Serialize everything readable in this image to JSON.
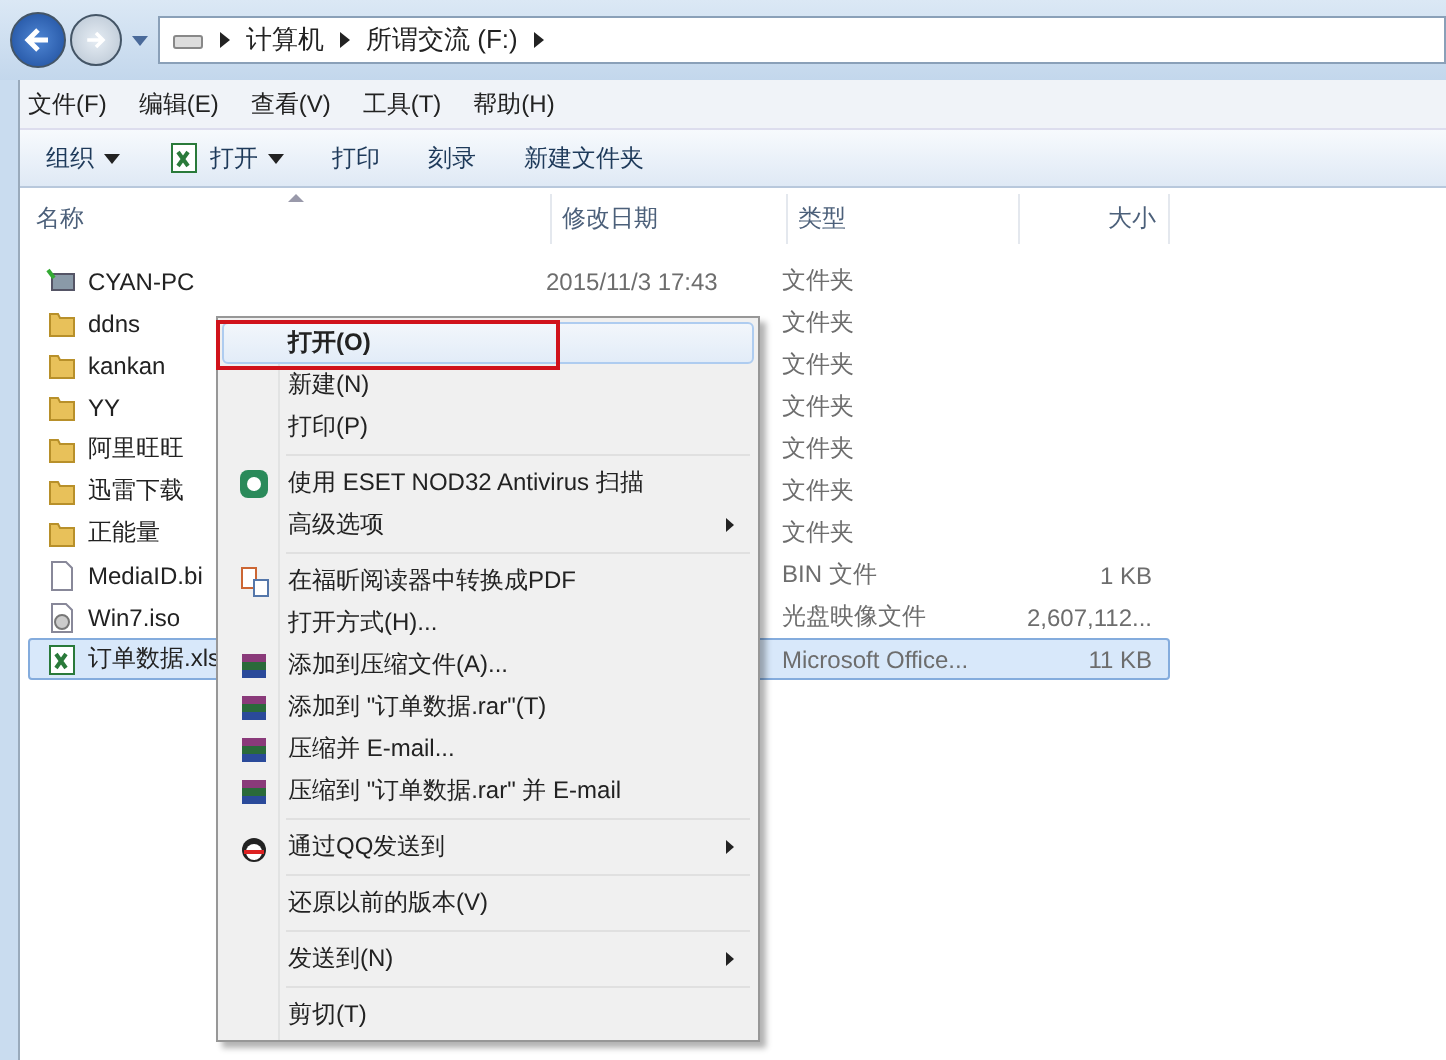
{
  "address_bar": {
    "crumbs": [
      "计算机",
      "所谓交流 (F:)"
    ]
  },
  "menu_bar": [
    "文件(F)",
    "编辑(E)",
    "查看(V)",
    "工具(T)",
    "帮助(H)"
  ],
  "toolbar": [
    {
      "label": "组织",
      "dropdown": true
    },
    {
      "label": "打开",
      "dropdown": true
    },
    {
      "label": "打印",
      "dropdown": false
    },
    {
      "label": "刻录",
      "dropdown": false
    },
    {
      "label": "新建文件夹",
      "dropdown": false
    }
  ],
  "columns": [
    "名称",
    "修改日期",
    "类型",
    "大小"
  ],
  "rows": [
    {
      "kind": "computer",
      "name": "CYAN-PC",
      "date": "2015/11/3 17:43",
      "type": "文件夹",
      "selected": false
    },
    {
      "kind": "folder",
      "name": "ddns",
      "type": "文件夹",
      "selected": false
    },
    {
      "kind": "folder",
      "name": "kankan",
      "type": "文件夹",
      "selected": false
    },
    {
      "kind": "folder",
      "name": "YY",
      "type": "文件夹",
      "selected": false
    },
    {
      "kind": "folder",
      "name": "阿里旺旺",
      "type": "文件夹",
      "selected": false
    },
    {
      "kind": "folder",
      "name": "迅雷下载",
      "type": "文件夹",
      "selected": false
    },
    {
      "kind": "folder",
      "name": "正能量",
      "type": "文件夹",
      "selected": false
    },
    {
      "kind": "file",
      "name": "MediaID.bi",
      "type": "BIN 文件",
      "size": "1 KB",
      "selected": false
    },
    {
      "kind": "disc",
      "name": "Win7.iso",
      "type": "光盘映像文件",
      "size": "2,607,112...",
      "selected": false
    },
    {
      "kind": "spreadsheet",
      "name": "订单数据.xls",
      "type": "Microsoft Office...",
      "size": "11 KB",
      "selected": true
    }
  ],
  "context_menu": [
    {
      "kind": "plain",
      "label": "打开(O)",
      "bold": true,
      "submenu": false,
      "selected": true,
      "annotated": true
    },
    {
      "kind": "plain",
      "label": "新建(N)",
      "bold": false,
      "submenu": false,
      "selected": false,
      "annotated": false
    },
    {
      "kind": "plain",
      "label": "打印(P)",
      "bold": false,
      "submenu": false,
      "selected": false,
      "annotated": false
    },
    {
      "kind": "separator"
    },
    {
      "kind": "scan",
      "label": "使用 ESET NOD32 Antivirus 扫描",
      "bold": false,
      "submenu": false,
      "selected": false,
      "annotated": false
    },
    {
      "kind": "plain",
      "label": "高级选项",
      "bold": false,
      "submenu": true,
      "selected": false,
      "annotated": false
    },
    {
      "kind": "separator"
    },
    {
      "kind": "pdf",
      "label": "在福昕阅读器中转换成PDF",
      "bold": false,
      "submenu": false,
      "selected": false,
      "annotated": false
    },
    {
      "kind": "plain",
      "label": "打开方式(H)...",
      "bold": false,
      "submenu": false,
      "selected": false,
      "annotated": false
    },
    {
      "kind": "archive",
      "label": "添加到压缩文件(A)...",
      "bold": false,
      "submenu": false,
      "selected": false,
      "annotated": false
    },
    {
      "kind": "archive",
      "label": "添加到 \"订单数据.rar\"(T)",
      "bold": false,
      "submenu": false,
      "selected": false,
      "annotated": false
    },
    {
      "kind": "archive",
      "label": "压缩并 E-mail...",
      "bold": false,
      "submenu": false,
      "selected": false,
      "annotated": false
    },
    {
      "kind": "archive",
      "label": "压缩到 \"订单数据.rar\" 并 E-mail",
      "bold": false,
      "submenu": false,
      "selected": false,
      "annotated": false
    },
    {
      "kind": "separator"
    },
    {
      "kind": "qq",
      "label": "通过QQ发送到",
      "bold": false,
      "submenu": true,
      "selected": false,
      "annotated": false
    },
    {
      "kind": "separator"
    },
    {
      "kind": "plain",
      "label": "还原以前的版本(V)",
      "bold": false,
      "submenu": false,
      "selected": false,
      "annotated": false
    },
    {
      "kind": "separator"
    },
    {
      "kind": "plain",
      "label": "发送到(N)",
      "bold": false,
      "submenu": true,
      "selected": false,
      "annotated": false
    },
    {
      "kind": "separator"
    },
    {
      "kind": "plain",
      "label": "剪切(T)",
      "bold": false,
      "submenu": false,
      "selected": false,
      "annotated": false
    }
  ]
}
